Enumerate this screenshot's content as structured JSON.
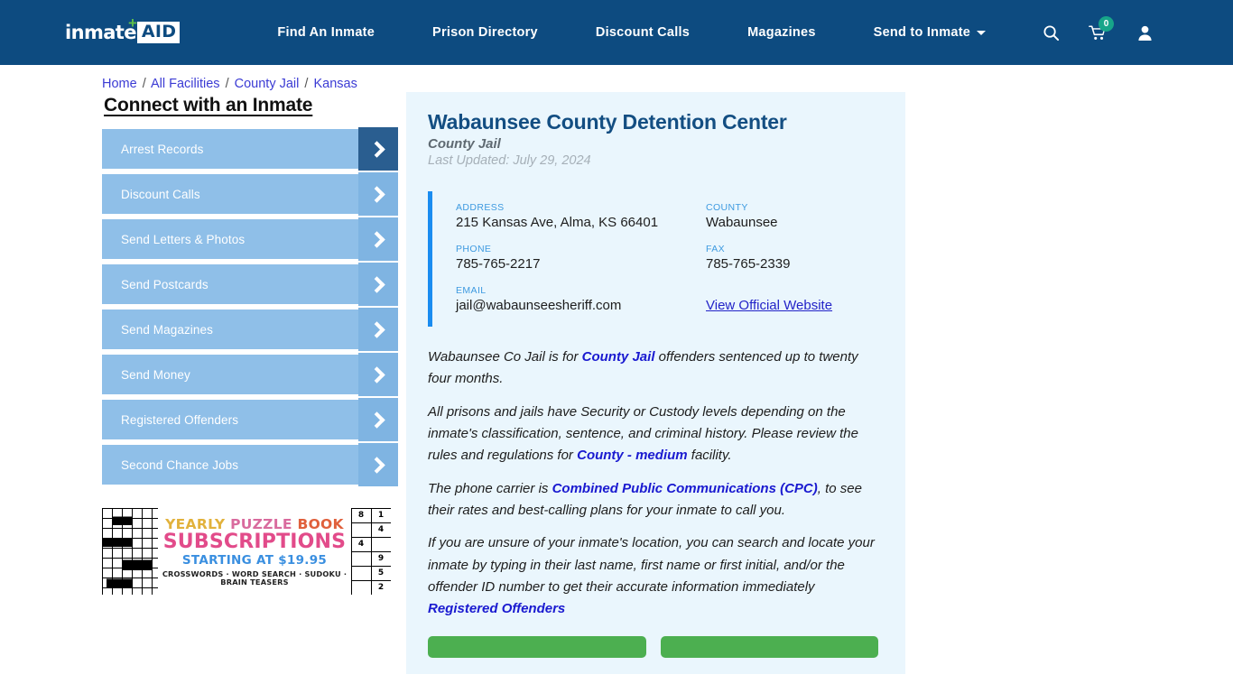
{
  "nav": {
    "logo": {
      "word": "inmate",
      "aid": "AID",
      "plus": "✛"
    },
    "links": [
      {
        "label": "Find An Inmate",
        "name": "find-an-inmate"
      },
      {
        "label": "Prison Directory",
        "name": "prison-directory"
      },
      {
        "label": "Discount Calls",
        "name": "discount-calls"
      },
      {
        "label": "Magazines",
        "name": "magazines"
      },
      {
        "label": "Send to Inmate",
        "name": "send-to-inmate",
        "dropdown": true
      }
    ],
    "icons": {
      "search": "search-icon",
      "cart": "cart-icon",
      "cart_count": "0",
      "account": "user-icon"
    },
    "bg_color": "#0d4b80"
  },
  "breadcrumb": {
    "items": [
      "Home",
      "All Facilities",
      "County Jail",
      "Kansas"
    ],
    "separator": "/"
  },
  "sidebar": {
    "title": "Connect with an Inmate",
    "items": [
      {
        "label": "Arrest Records",
        "active": true
      },
      {
        "label": "Discount Calls",
        "active": false
      },
      {
        "label": "Send Letters & Photos",
        "active": false
      },
      {
        "label": "Send Postcards",
        "active": false
      },
      {
        "label": "Send Magazines",
        "active": false
      },
      {
        "label": "Send Money",
        "active": false
      },
      {
        "label": "Registered Offenders",
        "active": false
      },
      {
        "label": "Second Chance Jobs",
        "active": false
      }
    ],
    "ad": {
      "line1_a": "YEARLY ",
      "line1_b": "PUZZLE ",
      "line1_c": "BOOK",
      "line2": "SUBSCRIPTIONS",
      "line3": "STARTING AT $19.95",
      "line4": "CROSSWORDS · WORD SEARCH · SUDOKU · BRAIN TEASERS",
      "sudoku_digits": [
        "8",
        "1",
        "",
        "4",
        "4",
        "",
        "",
        "9",
        "",
        "5",
        "",
        "2"
      ]
    }
  },
  "facility": {
    "title": "Wabaunsee County Detention Center",
    "type": "County Jail",
    "updated": "Last Updated: July 29, 2024",
    "info": {
      "address_label": "ADDRESS",
      "address_value": "215 Kansas Ave, Alma, KS 66401",
      "county_label": "COUNTY",
      "county_value": "Wabaunsee",
      "phone_label": "PHONE",
      "phone_value": "785-765-2217",
      "fax_label": "FAX",
      "fax_value": "785-765-2339",
      "email_label": "EMAIL",
      "email_value": "jail@wabaunseesheriff.com",
      "website_link": "View Official Website"
    },
    "paragraphs": [
      {
        "parts": [
          {
            "t": "Wabaunsee Co Jail is for ",
            "s": "plain"
          },
          {
            "t": "County Jail",
            "s": "bold"
          },
          {
            "t": " offenders sentenced up to twenty four months.",
            "s": "plain"
          }
        ]
      },
      {
        "parts": [
          {
            "t": "All prisons and jails have Security or Custody levels depending on the inmate's classification, sentence, and criminal history. Please review the rules and regulations for ",
            "s": "plain"
          },
          {
            "t": "County - medium",
            "s": "bold"
          },
          {
            "t": " facility.",
            "s": "plain"
          }
        ]
      },
      {
        "parts": [
          {
            "t": "The phone carrier is ",
            "s": "plain"
          },
          {
            "t": "Combined Public Communications (CPC)",
            "s": "bold"
          },
          {
            "t": ", to see their rates and best-calling plans for your inmate to call you.",
            "s": "plain"
          }
        ]
      },
      {
        "parts": [
          {
            "t": "If you are unsure of your inmate's location, you can search and locate your inmate by typing in their last name, first name or first initial, and/or the offender ID number to get their accurate information immediately ",
            "s": "plain"
          },
          {
            "t": "Registered Offenders",
            "s": "link"
          }
        ]
      }
    ],
    "cta": [
      {
        "label": ""
      },
      {
        "label": ""
      }
    ]
  },
  "colors": {
    "nav_blue": "#0d4b80",
    "card_blue": "#eaf6fd",
    "accent_bar": "#1a8cf0",
    "sidebar_item": "#8fbfe8",
    "sidebar_active_arrow": "#2a5e90",
    "link_blue": "#1a1ad0",
    "cta_green": "#4caf50",
    "badge_teal": "#17a589"
  }
}
